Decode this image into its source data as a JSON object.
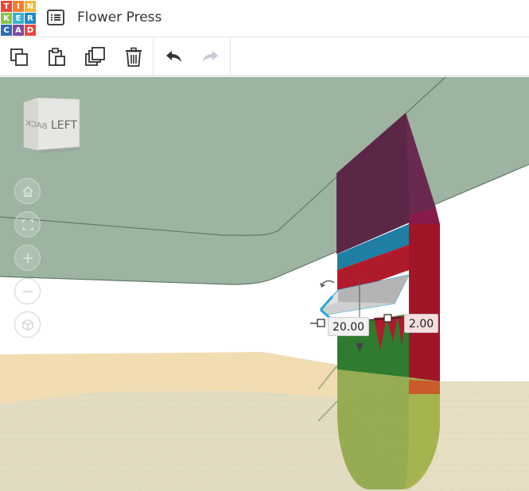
{
  "app": {
    "logo_letters": [
      "T",
      "I",
      "N",
      "K",
      "E",
      "R",
      "C",
      "A",
      "D"
    ],
    "logo_colors": [
      "#e8473a",
      "#f37e31",
      "#f5b732",
      "#89c34d",
      "#3ab3cb",
      "#1f88c6",
      "#2f6cb2",
      "#7d4a9e",
      "#e8473a"
    ],
    "title": "Flower Press"
  },
  "toolbar": {
    "icons": [
      "copy-icon",
      "paste-icon",
      "duplicate-icon",
      "delete-icon",
      "undo-icon",
      "redo-icon"
    ]
  },
  "viewcube": {
    "face_label": "LEFT",
    "back_label": "BACK"
  },
  "view_controls": [
    "home-view",
    "fit-view",
    "zoom-in",
    "zoom-out",
    "ortho-toggle"
  ],
  "dimensions": {
    "length": "20.00",
    "height": "2.00"
  },
  "colors": {
    "workplane": "#9eb5a3",
    "floor": "#f1dcb4",
    "accent": "#27a8d8",
    "maroon": "#5f2545",
    "red": "#a81628",
    "green": "#3b8a35"
  }
}
